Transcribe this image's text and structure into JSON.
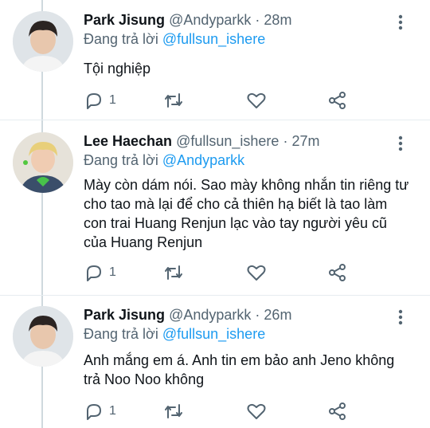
{
  "tweets": [
    {
      "name": "Park Jisung",
      "handle": "@Andyparkk",
      "time": "28m",
      "reply_prefix": "Đang trả lời",
      "reply_to": "@fullsun_ishere",
      "text": "Tội nghiệp",
      "reply_count": "1"
    },
    {
      "name": "Lee Haechan",
      "handle": "@fullsun_ishere",
      "time": "27m",
      "reply_prefix": "Đang trả lời",
      "reply_to": "@Andyparkk",
      "text": "Mày còn dám nói. Sao mày không nhắn tin riêng tư cho tao mà lại để cho cả thiên hạ biết là tao làm con trai Huang Renjun lạc vào tay người yêu cũ của Huang Renjun",
      "reply_count": "1"
    },
    {
      "name": "Park Jisung",
      "handle": "@Andyparkk",
      "time": "26m",
      "reply_prefix": "Đang trả lời",
      "reply_to": "@fullsun_ishere",
      "text": "Anh mắng em á. Anh tin em bảo anh Jeno không trả Noo Noo không",
      "reply_count": "1"
    }
  ],
  "separator": "·",
  "colors": {
    "link": "#1d9bf0",
    "muted": "#536471",
    "text": "#0f1419",
    "thread_line": "#cfd9de"
  },
  "icons": [
    "reply-icon",
    "retweet-icon",
    "like-icon",
    "share-icon",
    "more-icon"
  ]
}
